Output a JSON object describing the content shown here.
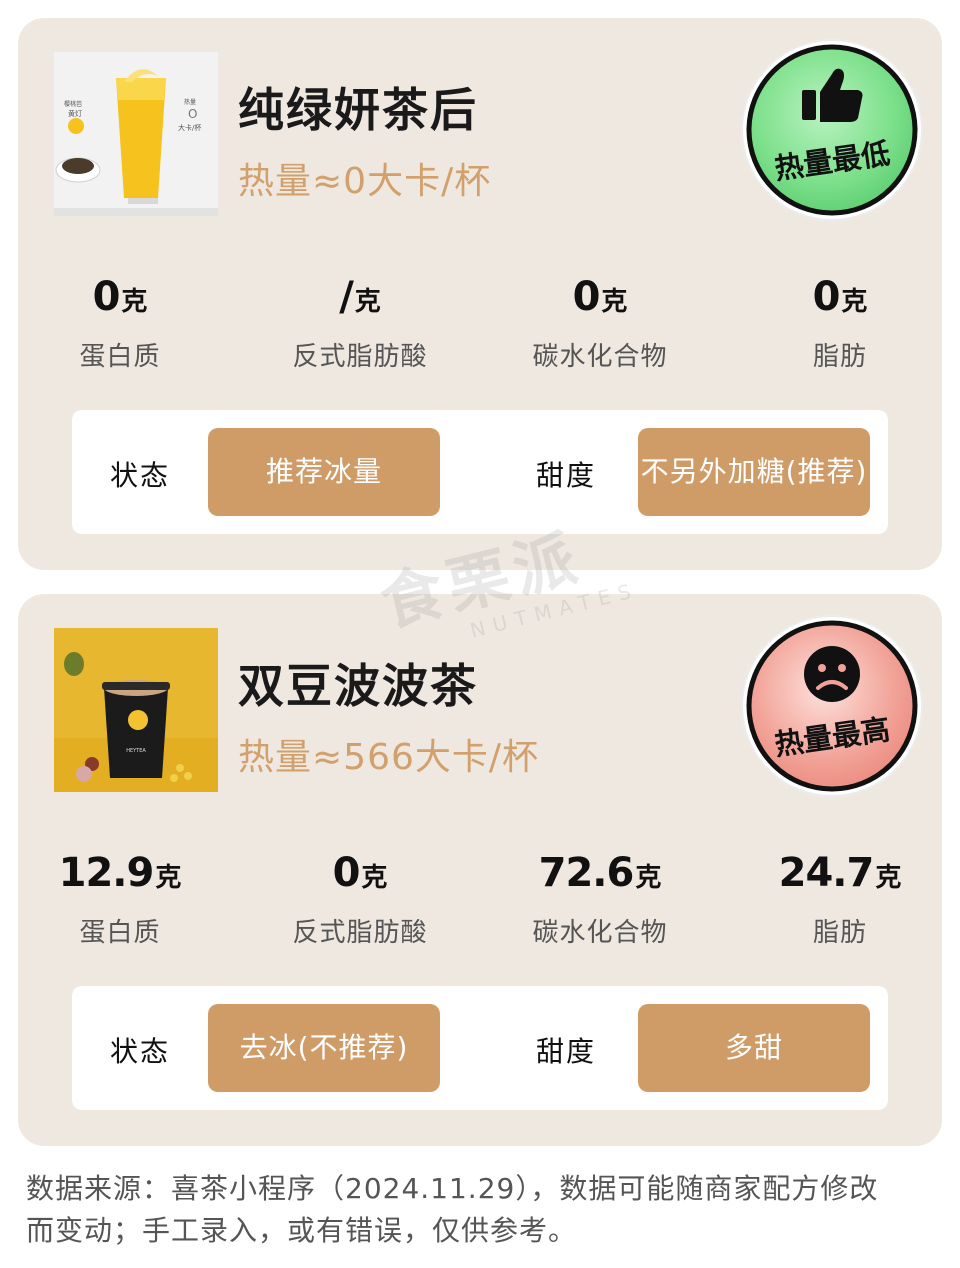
{
  "drinks": [
    {
      "name": "纯绿妍茶后",
      "kcal": "热量≈0大卡/杯",
      "badge": "热量最低",
      "thumb_texts": [
        "樱桃芭",
        "黄灯",
        "热量",
        "O",
        "大卡/杯"
      ],
      "stats": [
        {
          "value": "0",
          "unit": "克",
          "label": "蛋白质"
        },
        {
          "value": "/",
          "unit": "克",
          "label": "反式脂肪酸"
        },
        {
          "value": "0",
          "unit": "克",
          "label": "碳水化合物"
        },
        {
          "value": "0",
          "unit": "克",
          "label": "脂肪"
        }
      ],
      "options": {
        "state_label": "状态",
        "state_value": "推荐冰量",
        "sweet_label": "甜度",
        "sweet_value": "不另外加糖(推荐)"
      }
    },
    {
      "name": "双豆波波茶",
      "kcal": "热量≈566大卡/杯",
      "badge": "热量最高",
      "thumb_texts": [
        "HEYTEA"
      ],
      "stats": [
        {
          "value": "12.9",
          "unit": "克",
          "label": "蛋白质"
        },
        {
          "value": "0",
          "unit": "克",
          "label": "反式脂肪酸"
        },
        {
          "value": "72.6",
          "unit": "克",
          "label": "碳水化合物"
        },
        {
          "value": "24.7",
          "unit": "克",
          "label": "脂肪"
        }
      ],
      "options": {
        "state_label": "状态",
        "state_value": "去冰(不推荐)",
        "sweet_label": "甜度",
        "sweet_value": "多甜"
      }
    }
  ],
  "watermark": {
    "main": "食栗派",
    "sub": "NUTMATES"
  },
  "footer": {
    "line1": "数据来源：喜茶小程序（2024.11.29），数据可能随商家配方修改",
    "line2": "而变动；手工录入，或有错误，仅供参考。"
  },
  "colors": {
    "card_bg": "#efe8e1",
    "accent": "#d1a06c",
    "button": "#cf9c68",
    "badge_low": "#7ce08a",
    "badge_high": "#f2a398"
  },
  "icons": {
    "low": "thumbs-up-icon",
    "high": "sad-face-icon"
  }
}
